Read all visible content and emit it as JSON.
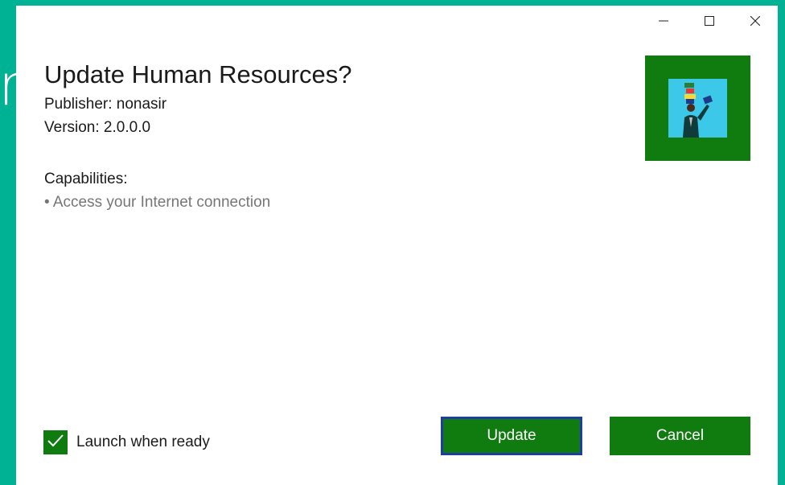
{
  "background": {
    "glyph": "r",
    "color": "#00b294"
  },
  "window": {
    "caption_buttons": [
      {
        "name": "minimize-icon"
      },
      {
        "name": "maximize-icon"
      },
      {
        "name": "close-icon"
      }
    ]
  },
  "dialog": {
    "title": "Update Human Resources?",
    "publisher": "Publisher: nonasir",
    "version": "Version: 2.0.0.0",
    "capabilities_heading": "Capabilities:",
    "capabilities": [
      "• Access your Internet connection"
    ],
    "app_tile_color": "#107c10",
    "app_logo_icon": "juggler-person-icon"
  },
  "footer": {
    "launch_checkbox": {
      "label": "Launch when ready",
      "checked": true
    },
    "update_label": "Update",
    "cancel_label": "Cancel",
    "accent_color": "#107c10"
  }
}
